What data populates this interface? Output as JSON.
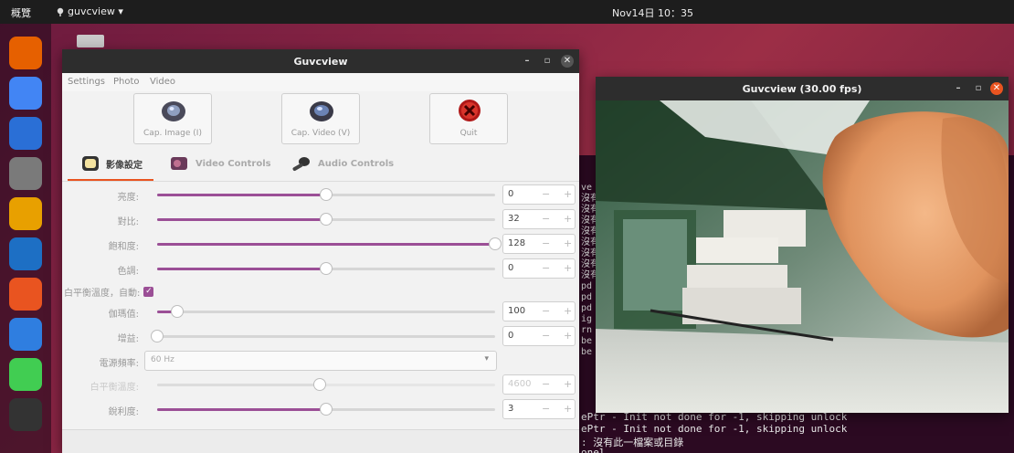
{
  "topbar": {
    "activities": "概覽",
    "app_menu": "guvcview ▾",
    "clock": "Nov14日 10：35"
  },
  "dock": {
    "items": [
      {
        "name": "firefox-icon",
        "color": "#e66000"
      },
      {
        "name": "chrome-icon",
        "color": "#4285f4"
      },
      {
        "name": "thunderbird-icon",
        "color": "#2a6fd6"
      },
      {
        "name": "files-icon",
        "color": "#7a7a7a"
      },
      {
        "name": "rhythmbox-icon",
        "color": "#e8a000"
      },
      {
        "name": "writer-icon",
        "color": "#1d6fc4"
      },
      {
        "name": "software-icon",
        "color": "#e95420"
      },
      {
        "name": "help-icon",
        "color": "#2f7ee0"
      },
      {
        "name": "qt-creator-icon",
        "color": "#41cd52"
      },
      {
        "name": "terminal-icon",
        "color": "#333333"
      }
    ]
  },
  "terminal": {
    "gutter": "ve\n沒有\n沒有\n沒有\n沒有\n沒有\n沒有\n沒有\n沒有\npd\npd\npd\nig\nrn\nbe\nbe",
    "lines": [
      "ePtr - Init not done for -1, skipping unlock",
      "ePtr - Init not done for -1, skipping unlock",
      ": 沒有此一檔案或目錄",
      "onel"
    ]
  },
  "control_window": {
    "title": "Guvcview",
    "menu": [
      "Settings",
      "Photo",
      "Video"
    ],
    "buttons": {
      "cap_image": "Cap. Image (I)",
      "cap_video": "Cap. Video (V)",
      "quit": "Quit"
    },
    "tabs": {
      "image": "影像設定",
      "video": "Video Controls",
      "audio": "Audio Controls"
    },
    "controls": [
      {
        "label": "亮度:",
        "value": "0",
        "fraction": 0.5,
        "disabled": false
      },
      {
        "label": "對比:",
        "value": "32",
        "fraction": 0.5,
        "disabled": false
      },
      {
        "label": "飽和度:",
        "value": "128",
        "fraction": 1.0,
        "disabled": false
      },
      {
        "label": "色調:",
        "value": "0",
        "fraction": 0.5,
        "disabled": false
      }
    ],
    "white_balance_auto": "白平衡溫度，自動:",
    "controls2": [
      {
        "label": "伽瑪值:",
        "value": "100",
        "fraction": 0.06,
        "disabled": false
      },
      {
        "label": "增益:",
        "value": "0",
        "fraction": 0.0,
        "disabled": false
      }
    ],
    "power_line": {
      "label": "電源頻率:",
      "value": "60 Hz"
    },
    "controls3": [
      {
        "label": "白平衡溫度:",
        "value": "4600",
        "fraction": 0.48,
        "disabled": true
      },
      {
        "label": "銳利度:",
        "value": "3",
        "fraction": 0.5,
        "disabled": false
      }
    ]
  },
  "preview_window": {
    "title": "Guvcview (30.00 fps)"
  }
}
